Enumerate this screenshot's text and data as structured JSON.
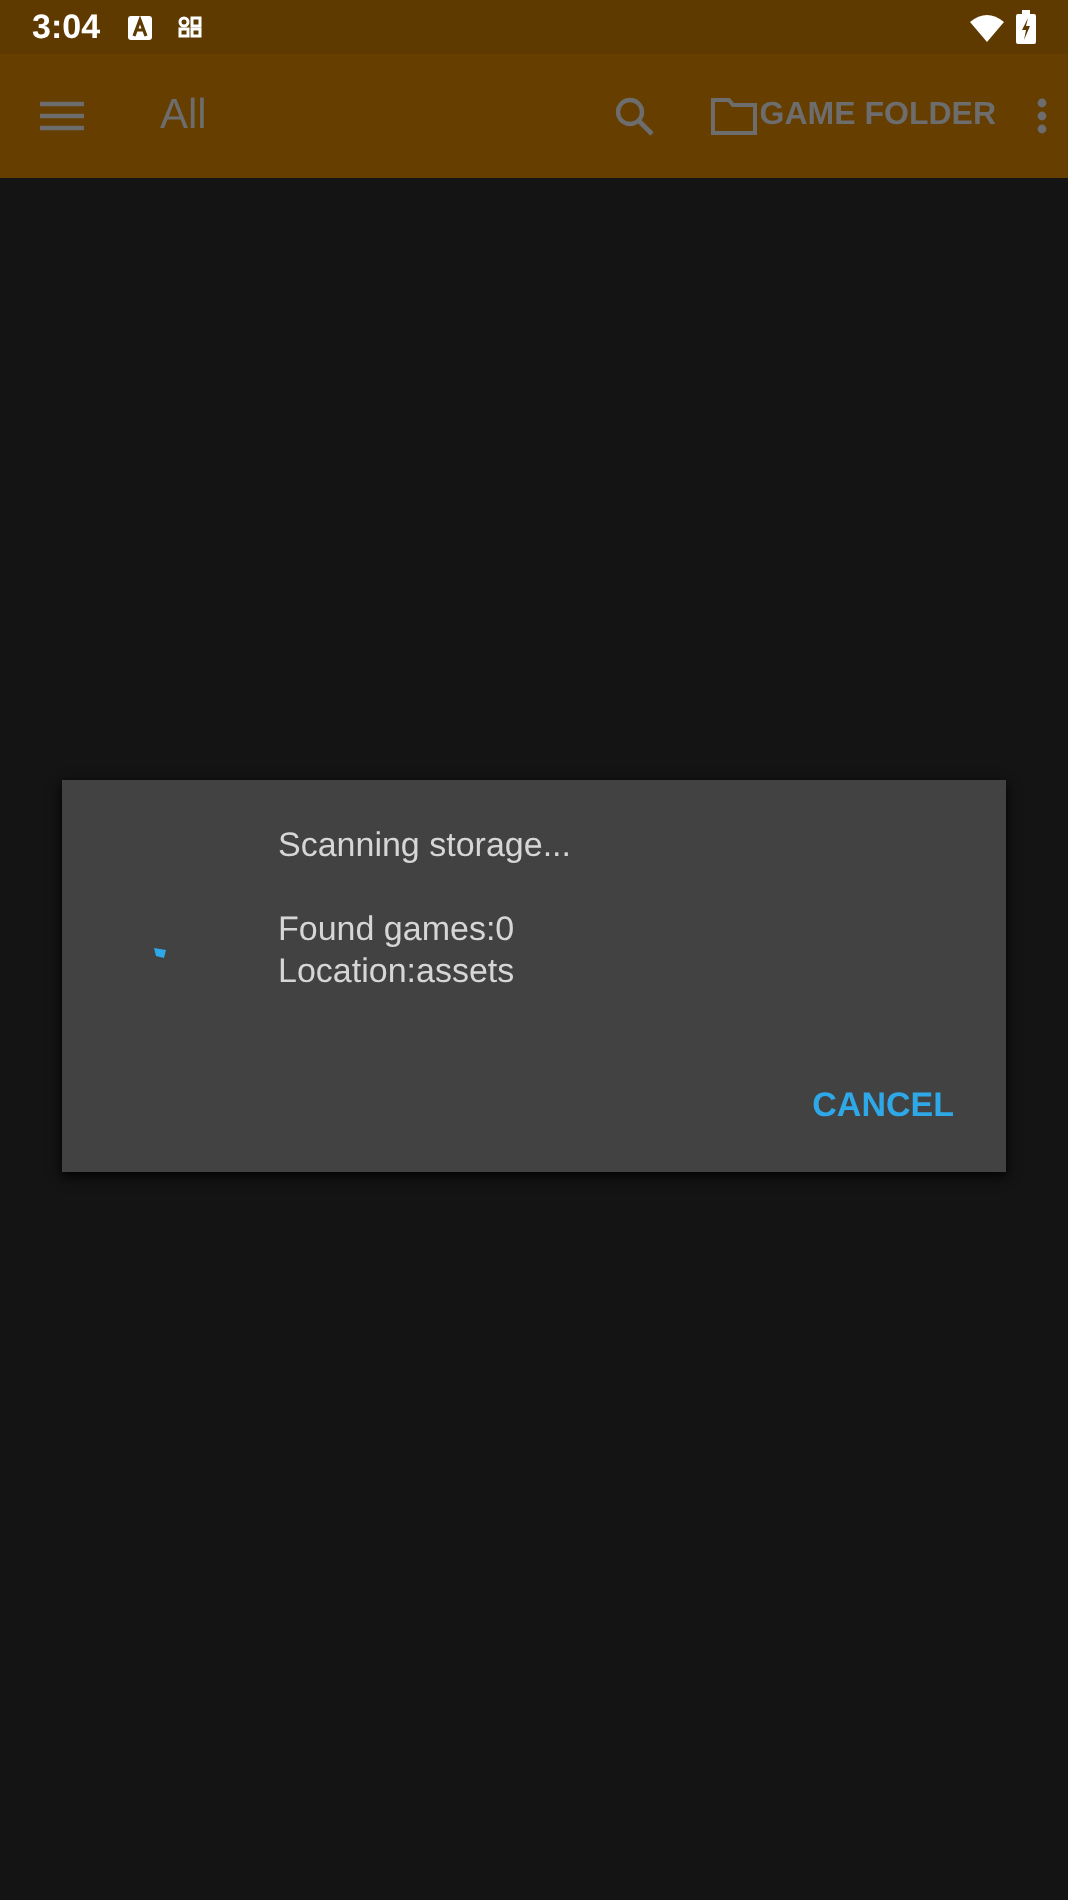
{
  "status_bar": {
    "time": "3:04"
  },
  "toolbar": {
    "title": "All",
    "actions": [
      {
        "kind": "search"
      },
      {
        "kind": "folder",
        "label": "GAME FOLDER"
      },
      {
        "kind": "overflow"
      }
    ]
  },
  "dialog": {
    "message": "Scanning storage...\n\nFound games:0\nLocation:assets",
    "buttons": [
      "CANCEL"
    ]
  }
}
